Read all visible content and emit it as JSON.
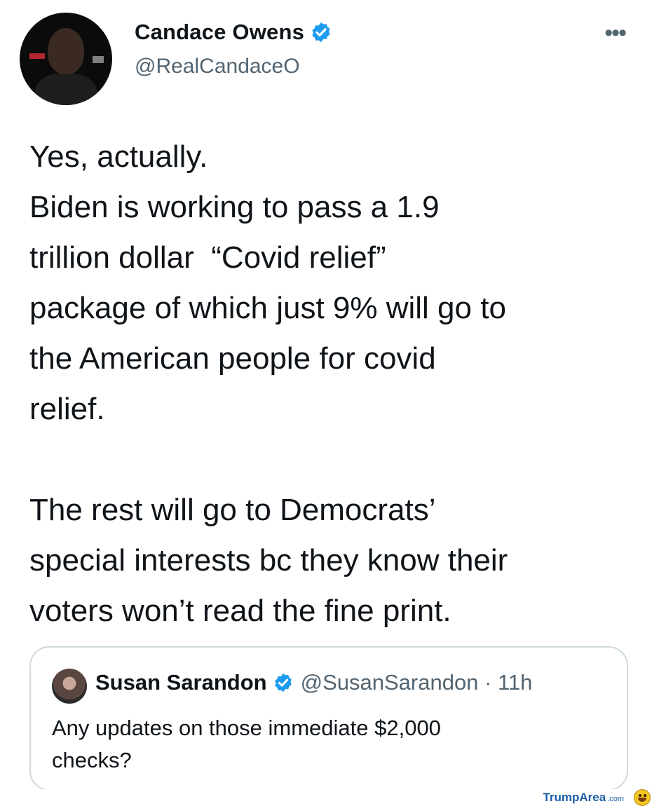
{
  "tweet": {
    "author": {
      "display_name": "Candace Owens",
      "handle": "@RealCandaceO",
      "verified_icon": "verified-badge-icon"
    },
    "more_icon": "more-options-icon",
    "more_glyph": "•••",
    "text": "Yes, actually.\nBiden is working to pass a 1.9\ntrillion dollar  “Covid relief”\npackage of which just 9% will go to\nthe American people for covid\nrelief.\n\nThe rest will go to Democrats’\nspecial interests bc they know their\nvoters won’t read the fine print.",
    "quoted_tweet": {
      "display_name": "Susan Sarandon",
      "handle_time": "@SusanSarandon · 11h",
      "text": "Any updates on those immediate $2,000\nchecks?"
    }
  },
  "watermark": {
    "brand": "TrumpArea",
    "suffix": ".com",
    "emoji_icon": "grinning-face-icon"
  },
  "colors": {
    "verified_blue": "#1d9bf0",
    "secondary_text": "#536471",
    "border": "#cfd9de"
  }
}
